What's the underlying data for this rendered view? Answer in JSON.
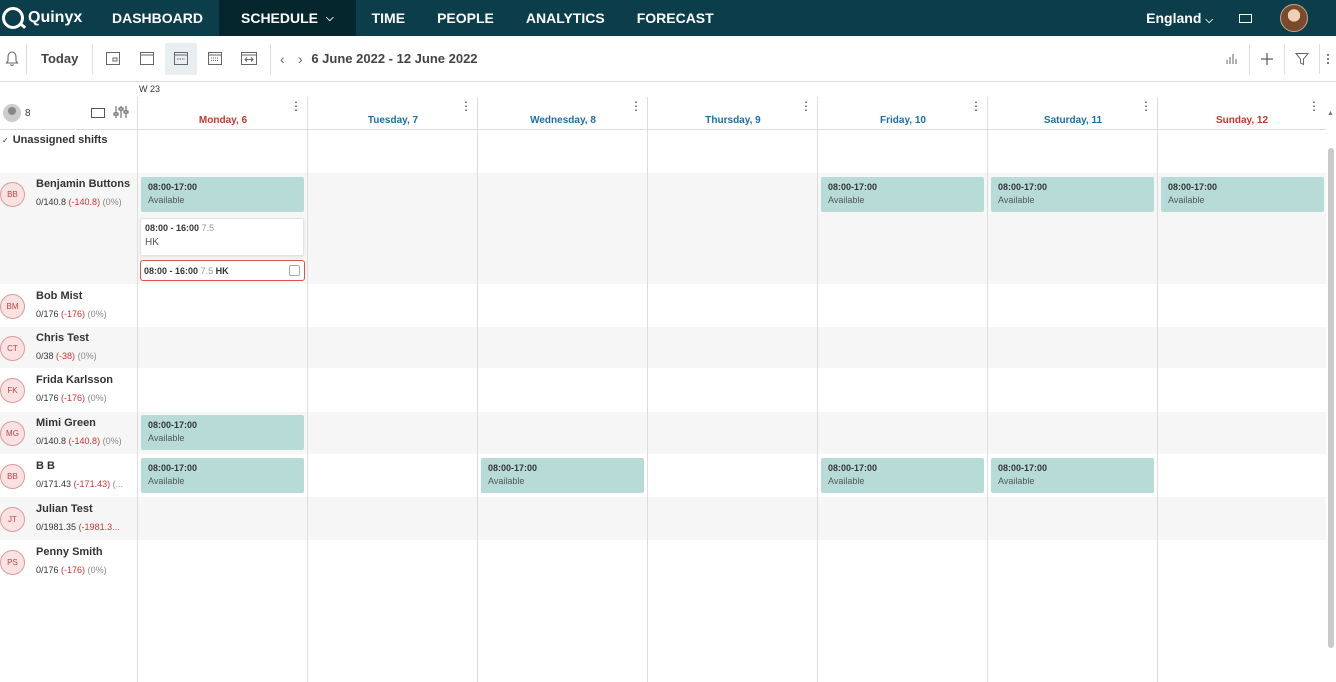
{
  "nav": {
    "logo_text": "Quinyx",
    "items": [
      "DASHBOARD",
      "SCHEDULE",
      "TIME",
      "PEOPLE",
      "ANALYTICS",
      "FORECAST"
    ],
    "region": "England"
  },
  "toolbar": {
    "today": "Today",
    "date_range": "6 June 2022 - 12 June 2022"
  },
  "grid": {
    "week": "W 23",
    "employee_count": "8",
    "days": [
      "Monday, 6",
      "Tuesday, 7",
      "Wednesday, 8",
      "Thursday, 9",
      "Friday, 10",
      "Saturday, 11",
      "Sunday, 12"
    ],
    "weekday_color": "#1a6ea8",
    "weekend_color": "#c0392b",
    "unassigned_label": "Unassigned shifts"
  },
  "employees": [
    {
      "initials": "BB",
      "name": "Benjamin Buttons",
      "hours": "0/140.8",
      "neg": "(-140.8)",
      "pct": "(0%)"
    },
    {
      "initials": "BM",
      "name": "Bob Mist",
      "hours": "0/176",
      "neg": "(-176)",
      "pct": "(0%)"
    },
    {
      "initials": "CT",
      "name": "Chris Test",
      "hours": "0/38",
      "neg": "(-38)",
      "pct": "(0%)"
    },
    {
      "initials": "FK",
      "name": "Frida Karlsson",
      "hours": "0/176",
      "neg": "(-176)",
      "pct": "(0%)"
    },
    {
      "initials": "MG",
      "name": "Mimi Green",
      "hours": "0/140.8",
      "neg": "(-140.8)",
      "pct": "(0%)"
    },
    {
      "initials": "BB",
      "name": "B B",
      "hours": "0/171.43",
      "neg": "(-171.43)",
      "pct": "(..."
    },
    {
      "initials": "JT",
      "name": "Julian Test",
      "hours": "0/1981.35",
      "neg": "(-1981.3...",
      "pct": ""
    },
    {
      "initials": "PS",
      "name": "Penny Smith",
      "hours": "0/176",
      "neg": "(-176)",
      "pct": "(0%)"
    }
  ],
  "availability": {
    "time": "08:00-17:00",
    "status": "Available"
  },
  "shift_card": {
    "time": "08:00 - 16:00",
    "duration": "7.5",
    "code": "HK"
  }
}
